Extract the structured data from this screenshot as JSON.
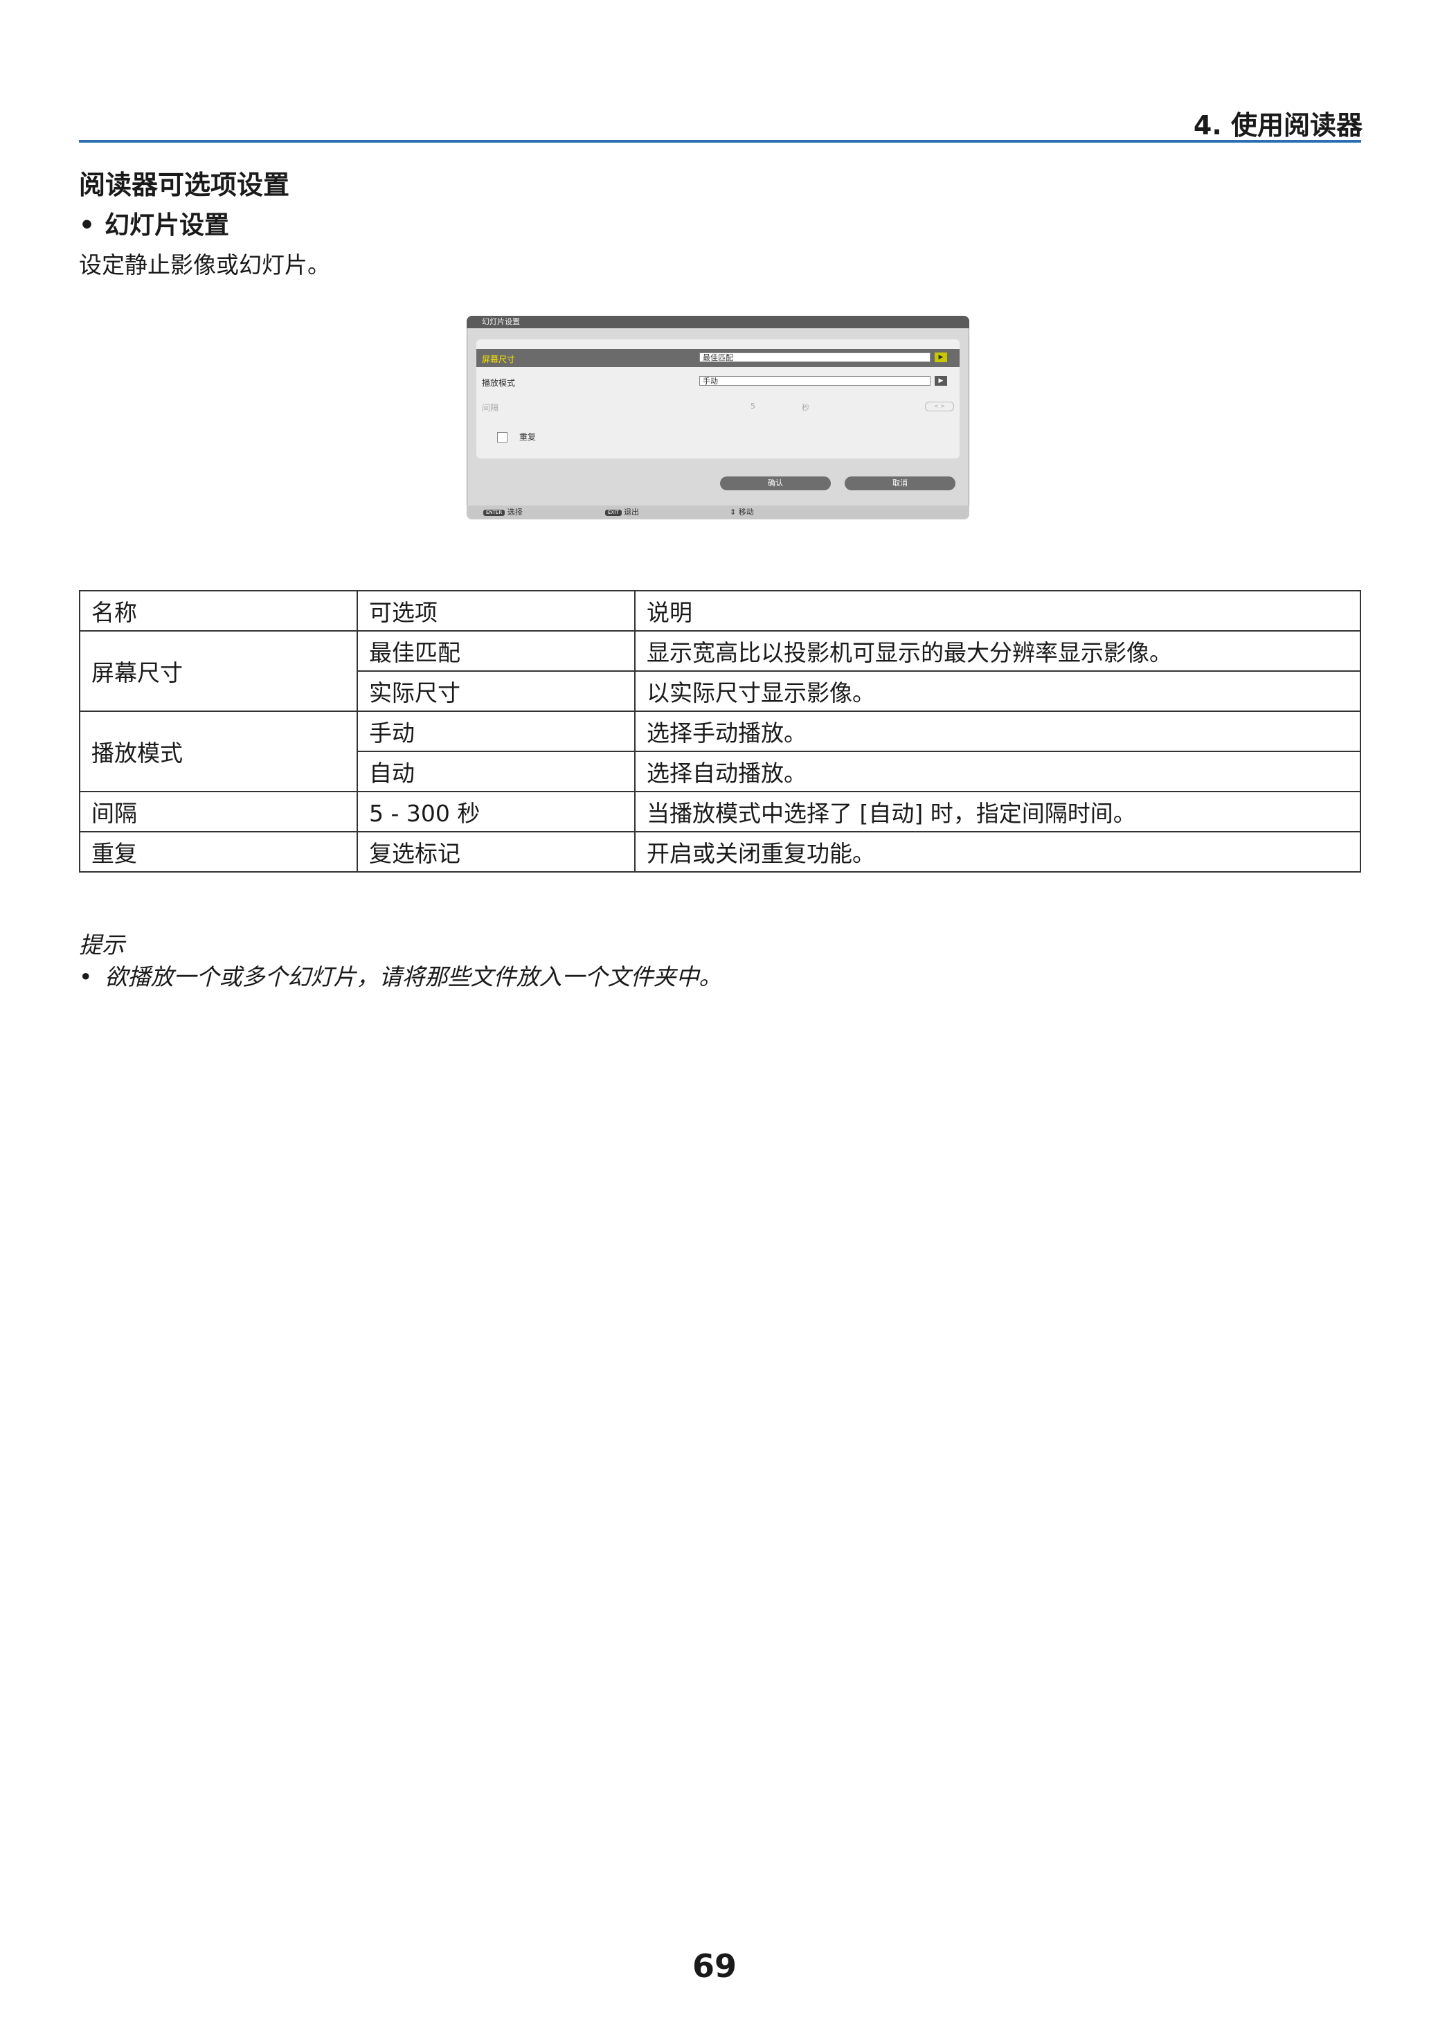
{
  "header": {
    "chapter": "4. 使用阅读器"
  },
  "section": {
    "title": "阅读器可选项设置",
    "subtitle_bullet": "•",
    "subtitle": "幻灯片设置",
    "intro": "设定静止影像或幻灯片。"
  },
  "dialog": {
    "title": "幻灯片设置",
    "rows": [
      {
        "label": "屏幕尺寸",
        "value": "最佳匹配",
        "arrow": "▶"
      },
      {
        "label": "播放模式",
        "value": "手动",
        "arrow": "▶"
      },
      {
        "label": "间隔",
        "number": "5",
        "unit": "秒",
        "spin": "< >"
      }
    ],
    "repeat_label": "重复",
    "ok_button": "确认",
    "cancel_button": "取消",
    "footer": {
      "enter_key": "ENTER",
      "enter_label": "选择",
      "exit_key": "EXIT",
      "exit_label": "退出",
      "move_symbol": "⇕",
      "move_label": "移动"
    }
  },
  "table": {
    "headers": [
      "名称",
      "可选项",
      "说明"
    ],
    "rows": [
      [
        "屏幕尺寸",
        "最佳匹配",
        "显示宽高比以投影机可显示的最大分辨率显示影像。"
      ],
      [
        "",
        "实际尺寸",
        "以实际尺寸显示影像。"
      ],
      [
        "播放模式",
        "手动",
        "选择手动播放。"
      ],
      [
        "",
        "自动",
        "选择自动播放。"
      ],
      [
        "间隔",
        "5 - 300 秒",
        "当播放模式中选择了 [自动] 时，指定间隔时间。"
      ],
      [
        "重复",
        "复选标记",
        "开启或关闭重复功能。"
      ]
    ]
  },
  "tip": {
    "title": "提示",
    "bullet": "•",
    "text": "欲播放一个或多个幻灯片，请将那些文件放入一个文件夹中。"
  },
  "page_number": "69"
}
